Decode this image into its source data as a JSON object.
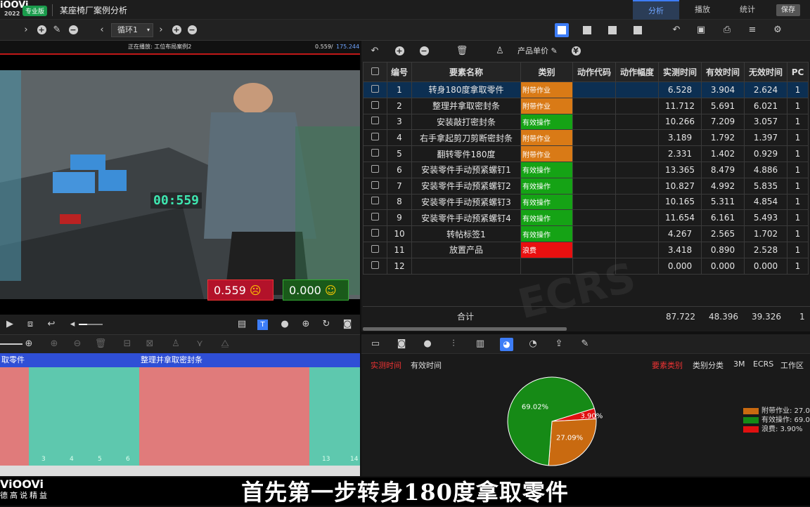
{
  "app": {
    "logo": "iOOVi",
    "logo_year": "2022",
    "edition": "专业版",
    "project_title": "某座椅厂案例分析",
    "top_tabs": [
      {
        "label": "分析",
        "active": true
      },
      {
        "label": "播放",
        "active": false
      },
      {
        "label": "统计",
        "active": false
      }
    ],
    "save_label": "保存"
  },
  "toolbar": {
    "loop_select": "循环1"
  },
  "video": {
    "now_playing": "正在播放: 工位布局案例2",
    "time_current": "0.559/",
    "time_total": "175.244",
    "timer_overlay": "00:559",
    "value_left": "0.559",
    "value_right": "0.000"
  },
  "timeline": {
    "segments": [
      {
        "label": "取零件",
        "color": "#e07b7b"
      },
      {
        "label": "",
        "color": "#5ec8ae"
      },
      {
        "label": "整理并拿取密封条",
        "color": "#e07b7b"
      },
      {
        "label": "",
        "color": "#5ec8ae"
      }
    ],
    "ticks": [
      "3",
      "4",
      "5",
      "6",
      "13",
      "14"
    ]
  },
  "table": {
    "toolbar_label": "产品单价",
    "watermark": "ECRS",
    "headers": [
      "编号",
      "要素名称",
      "类别",
      "动作代码",
      "动作幅度",
      "实测时间",
      "有效时间",
      "无效时间",
      "PC"
    ],
    "rows": [
      {
        "no": "1",
        "name": "转身180度拿取零件",
        "cat": "附带作业",
        "catcolor": "#d97a16",
        "t1": "6.528",
        "t2": "3.904",
        "t3": "2.624",
        "pc": "1",
        "sel": true
      },
      {
        "no": "2",
        "name": "整理并拿取密封条",
        "cat": "附带作业",
        "catcolor": "#d97a16",
        "t1": "11.712",
        "t2": "5.691",
        "t3": "6.021",
        "pc": "1"
      },
      {
        "no": "3",
        "name": "安装敲打密封条",
        "cat": "有效操作",
        "catcolor": "#15a315",
        "t1": "10.266",
        "t2": "7.209",
        "t3": "3.057",
        "pc": "1"
      },
      {
        "no": "4",
        "name": "右手拿起剪刀剪断密封条",
        "cat": "附带作业",
        "catcolor": "#d97a16",
        "t1": "3.189",
        "t2": "1.792",
        "t3": "1.397",
        "pc": "1"
      },
      {
        "no": "5",
        "name": "翻转零件180度",
        "cat": "附带作业",
        "catcolor": "#d97a16",
        "t1": "2.331",
        "t2": "1.402",
        "t3": "0.929",
        "pc": "1"
      },
      {
        "no": "6",
        "name": "安装零件手动预紧螺钉1",
        "cat": "有效操作",
        "catcolor": "#15a315",
        "t1": "13.365",
        "t2": "8.479",
        "t3": "4.886",
        "pc": "1"
      },
      {
        "no": "7",
        "name": "安装零件手动预紧螺钉2",
        "cat": "有效操作",
        "catcolor": "#15a315",
        "t1": "10.827",
        "t2": "4.992",
        "t3": "5.835",
        "pc": "1"
      },
      {
        "no": "8",
        "name": "安装零件手动预紧螺钉3",
        "cat": "有效操作",
        "catcolor": "#15a315",
        "t1": "10.165",
        "t2": "5.311",
        "t3": "4.854",
        "pc": "1"
      },
      {
        "no": "9",
        "name": "安装零件手动预紧螺钉4",
        "cat": "有效操作",
        "catcolor": "#15a315",
        "t1": "11.654",
        "t2": "6.161",
        "t3": "5.493",
        "pc": "1"
      },
      {
        "no": "10",
        "name": "转帖标签1",
        "cat": "有效操作",
        "catcolor": "#15a315",
        "t1": "4.267",
        "t2": "2.565",
        "t3": "1.702",
        "pc": "1"
      },
      {
        "no": "11",
        "name": "放置产品",
        "cat": "浪费",
        "catcolor": "#e81010",
        "t1": "3.418",
        "t2": "0.890",
        "t3": "2.528",
        "pc": "1"
      },
      {
        "no": "12",
        "name": "",
        "cat": "",
        "catcolor": "",
        "t1": "0.000",
        "t2": "0.000",
        "t3": "0.000",
        "pc": "1"
      }
    ],
    "total_label": "合计",
    "total_t1": "87.722",
    "total_t2": "48.396",
    "total_t3": "39.326",
    "total_pc": "1"
  },
  "chart_tabs_left": [
    {
      "label": "实测时间",
      "active": true
    },
    {
      "label": "有效时间",
      "active": false
    }
  ],
  "chart_tabs_right": [
    {
      "label": "要素类别",
      "active": true
    },
    {
      "label": "类别分类",
      "active": false
    },
    {
      "label": "3M",
      "active": false
    },
    {
      "label": "ECRS",
      "active": false
    },
    {
      "label": "工作区",
      "active": false
    }
  ],
  "chart_data": {
    "type": "pie",
    "labels": [
      "有效操作",
      "附带作业",
      "浪费"
    ],
    "values": [
      69.02,
      27.09,
      3.9
    ],
    "colors": [
      "#168a16",
      "#c96a10",
      "#e01010"
    ],
    "slice_labels": [
      "69.02%",
      "27.09%",
      "3.90%"
    ],
    "legend": [
      "附带作业: 27.0",
      "有效操作: 69.0",
      "浪费: 3.90%"
    ]
  },
  "subtitle": {
    "logo": "ViOOVi",
    "logo_tag": "德高说精益",
    "text": "首先第一步转身180度拿取零件"
  }
}
